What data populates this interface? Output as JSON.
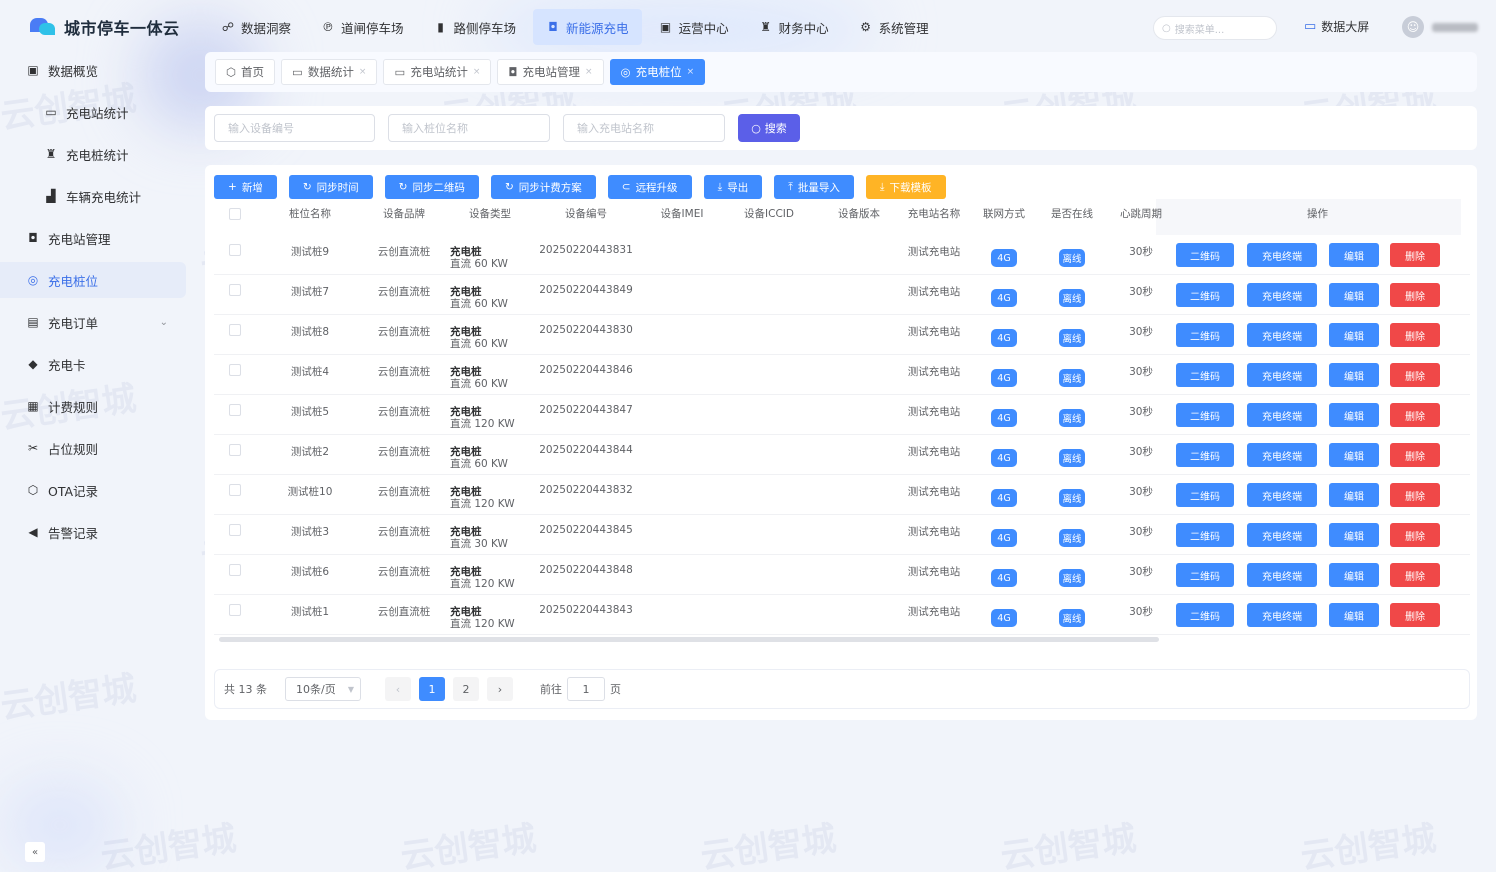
{
  "app": {
    "title": "城市停车一体云"
  },
  "topnav": [
    {
      "label": "数据洞察",
      "icon": "data-insight-icon",
      "glyph": "☍"
    },
    {
      "label": "道闸停车场",
      "icon": "barrier-parking-icon",
      "glyph": "℗"
    },
    {
      "label": "路侧停车场",
      "icon": "roadside-parking-icon",
      "glyph": "▮"
    },
    {
      "label": "新能源充电",
      "icon": "ev-charging-icon",
      "glyph": "◘",
      "active": true
    },
    {
      "label": "运营中心",
      "icon": "operation-icon",
      "glyph": "▣"
    },
    {
      "label": "财务中心",
      "icon": "finance-icon",
      "glyph": "♜"
    },
    {
      "label": "系统管理",
      "icon": "system-gear-icon",
      "glyph": "⚙"
    }
  ],
  "header": {
    "search_placeholder": "搜索菜单...",
    "bigscreen_label": "数据大屏"
  },
  "sidebar": {
    "items": [
      {
        "label": "数据概览",
        "icon": "overview-icon",
        "glyph": "▣",
        "level": 0
      },
      {
        "label": "充电站统计",
        "icon": "station-stats-icon",
        "glyph": "▭",
        "level": 1
      },
      {
        "label": "充电桩统计",
        "icon": "pile-stats-icon",
        "glyph": "♜",
        "level": 1
      },
      {
        "label": "车辆充电统计",
        "icon": "vehicle-stats-icon",
        "glyph": "▟",
        "level": 1
      },
      {
        "label": "充电站管理",
        "icon": "station-manage-icon",
        "glyph": "◘",
        "level": 0
      },
      {
        "label": "充电桩位",
        "icon": "pile-position-icon",
        "glyph": "◎",
        "level": 0,
        "active": true
      },
      {
        "label": "充电订单",
        "icon": "order-icon",
        "glyph": "▤",
        "level": 0,
        "expand": true
      },
      {
        "label": "充电卡",
        "icon": "card-icon",
        "glyph": "◆",
        "level": 0
      },
      {
        "label": "计费规则",
        "icon": "billing-icon",
        "glyph": "▦",
        "level": 0
      },
      {
        "label": "占位规则",
        "icon": "occupy-icon",
        "glyph": "✂",
        "level": 0
      },
      {
        "label": "OTA记录",
        "icon": "ota-icon",
        "glyph": "⬡",
        "level": 0
      },
      {
        "label": "告警记录",
        "icon": "alarm-icon",
        "glyph": "◀",
        "level": 0
      }
    ],
    "collapse_glyph": "«"
  },
  "tags": [
    {
      "label": "首页",
      "icon": "home-icon",
      "glyph": "⬡",
      "closable": false
    },
    {
      "label": "数据统计",
      "icon": "monitor-icon",
      "glyph": "▭",
      "closable": true
    },
    {
      "label": "充电站统计",
      "icon": "monitor-icon",
      "glyph": "▭",
      "closable": true
    },
    {
      "label": "充电站管理",
      "icon": "station-icon",
      "glyph": "◘",
      "closable": true
    },
    {
      "label": "充电桩位",
      "icon": "target-icon",
      "glyph": "◎",
      "closable": true,
      "active": true
    }
  ],
  "search": {
    "device_no_placeholder": "输入设备编号",
    "pile_name_placeholder": "输入桩位名称",
    "station_name_placeholder": "输入充电站名称",
    "search_label": "搜索"
  },
  "toolbar": [
    {
      "label": "新增",
      "glyph": "+"
    },
    {
      "label": "同步时间",
      "glyph": "↻"
    },
    {
      "label": "同步二维码",
      "glyph": "↻"
    },
    {
      "label": "同步计费方案",
      "glyph": "↻"
    },
    {
      "label": "远程升级",
      "glyph": "⊂"
    },
    {
      "label": "导出",
      "glyph": "⤓"
    },
    {
      "label": "批量导入",
      "glyph": "⤒"
    },
    {
      "label": "下载模板",
      "glyph": "⤓",
      "warn": true
    }
  ],
  "table": {
    "columns": [
      "桩位名称",
      "设备品牌",
      "设备类型",
      "设备编号",
      "设备IMEI",
      "设备ICCID",
      "设备版本",
      "充电站名称",
      "联网方式",
      "是否在线",
      "心跳周期",
      "操作"
    ],
    "rows": [
      {
        "name": "测试桩9",
        "brand": "云创直流桩",
        "type1": "充电桩",
        "type2": "直流 60 KW",
        "device_no": "20250220443831",
        "station": "测试充电站",
        "net": "4G",
        "online": "离线",
        "heartbeat": "30秒"
      },
      {
        "name": "测试桩7",
        "brand": "云创直流桩",
        "type1": "充电桩",
        "type2": "直流 60 KW",
        "device_no": "20250220443849",
        "station": "测试充电站",
        "net": "4G",
        "online": "离线",
        "heartbeat": "30秒"
      },
      {
        "name": "测试桩8",
        "brand": "云创直流桩",
        "type1": "充电桩",
        "type2": "直流 60 KW",
        "device_no": "20250220443830",
        "station": "测试充电站",
        "net": "4G",
        "online": "离线",
        "heartbeat": "30秒"
      },
      {
        "name": "测试桩4",
        "brand": "云创直流桩",
        "type1": "充电桩",
        "type2": "直流 60 KW",
        "device_no": "20250220443846",
        "station": "测试充电站",
        "net": "4G",
        "online": "离线",
        "heartbeat": "30秒"
      },
      {
        "name": "测试桩5",
        "brand": "云创直流桩",
        "type1": "充电桩",
        "type2": "直流 120 KW",
        "device_no": "20250220443847",
        "station": "测试充电站",
        "net": "4G",
        "online": "离线",
        "heartbeat": "30秒"
      },
      {
        "name": "测试桩2",
        "brand": "云创直流桩",
        "type1": "充电桩",
        "type2": "直流 60 KW",
        "device_no": "20250220443844",
        "station": "测试充电站",
        "net": "4G",
        "online": "离线",
        "heartbeat": "30秒"
      },
      {
        "name": "测试桩10",
        "brand": "云创直流桩",
        "type1": "充电桩",
        "type2": "直流 120 KW",
        "device_no": "20250220443832",
        "station": "测试充电站",
        "net": "4G",
        "online": "离线",
        "heartbeat": "30秒"
      },
      {
        "name": "测试桩3",
        "brand": "云创直流桩",
        "type1": "充电桩",
        "type2": "直流 30 KW",
        "device_no": "20250220443845",
        "station": "测试充电站",
        "net": "4G",
        "online": "离线",
        "heartbeat": "30秒"
      },
      {
        "name": "测试桩6",
        "brand": "云创直流桩",
        "type1": "充电桩",
        "type2": "直流 120 KW",
        "device_no": "20250220443848",
        "station": "测试充电站",
        "net": "4G",
        "online": "离线",
        "heartbeat": "30秒"
      },
      {
        "name": "测试桩1",
        "brand": "云创直流桩",
        "type1": "充电桩",
        "type2": "直流 120 KW",
        "device_no": "20250220443843",
        "station": "测试充电站",
        "net": "4G",
        "online": "离线",
        "heartbeat": "30秒"
      }
    ],
    "actions": [
      "二维码",
      "充电终端",
      "编辑",
      "删除"
    ]
  },
  "pagination": {
    "total": "共 13 条",
    "page_size": "10条/页",
    "pages": [
      "1",
      "2"
    ],
    "current": "1",
    "goto_label": "前往",
    "goto_value": "1",
    "goto_unit": "页"
  },
  "watermark": "云创智城",
  "colors": {
    "primary": "#3f8cff",
    "danger": "#f04848",
    "warning": "#ffb425",
    "search": "#5b5fe8"
  }
}
